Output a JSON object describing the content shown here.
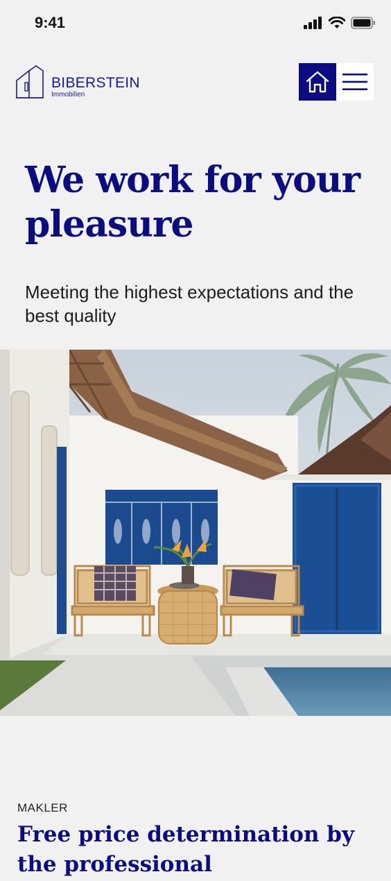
{
  "status_bar": {
    "time": "9:41"
  },
  "header": {
    "brand_name": "BIBERSTEIN",
    "brand_sub": "Immobilien",
    "home_icon": "home-icon",
    "menu_icon": "hamburger-menu-icon"
  },
  "hero": {
    "title": "We work for your pleasure",
    "subtitle": "Meeting the highest expectations and the best quality"
  },
  "section": {
    "label": "MAKLER",
    "title": "Free price determination by the professional"
  },
  "colors": {
    "brand": "#0b0b82",
    "background": "#f1f1f2"
  }
}
